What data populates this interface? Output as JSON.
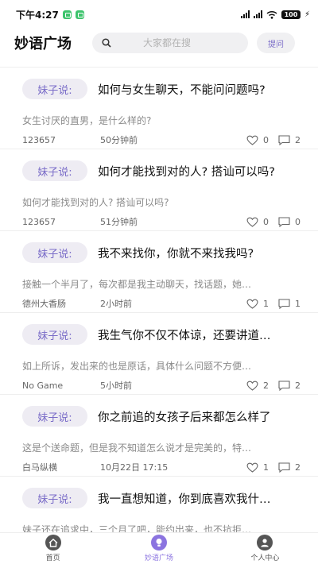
{
  "status_bar": {
    "time": "下午4:27",
    "battery": "100"
  },
  "header": {
    "title": "妙语广场",
    "search_placeholder": "大家都在搜",
    "ask_label": "提问"
  },
  "posts": [
    {
      "tag": "妹子说:",
      "title": "如何与女生聊天，不能问问题吗?",
      "desc": "女生讨厌的直男，是什么样的?",
      "author": "123657",
      "time": "50分钟前",
      "likes": "0",
      "comments": "2"
    },
    {
      "tag": "妹子说:",
      "title": "如何才能找到对的人? 搭讪可以吗?",
      "desc": "如何才能找到对的人? 搭讪可以吗?",
      "author": "123657",
      "time": "51分钟前",
      "likes": "0",
      "comments": "0"
    },
    {
      "tag": "妹子说:",
      "title": "我不来找你，你就不来找我吗?",
      "desc": "接触一个半月了，每次都是我主动聊天，找话题，她…",
      "author": "德州大香肠",
      "time": "2小时前",
      "likes": "1",
      "comments": "1"
    },
    {
      "tag": "妹子说:",
      "title": "我生气你不仅不体谅，还要讲道…",
      "desc": "如上所诉，发出来的也是原话，具体什么问题不方便…",
      "author": "No Game",
      "time": "5小时前",
      "likes": "2",
      "comments": "2"
    },
    {
      "tag": "妹子说:",
      "title": "你之前追的女孩子后来都怎么样了",
      "desc": "这是个送命题，但是我不知道怎么说才是完美的，特…",
      "author": "白马纵横",
      "time": "10月22日 17:15",
      "likes": "1",
      "comments": "2"
    },
    {
      "tag": "妹子说:",
      "title": "我一直想知道，你到底喜欢我什…",
      "desc": "妹子还在追求中，三个月了吧，能约出来，也不抗拒…",
      "author": "",
      "time": "",
      "likes": "",
      "comments": ""
    }
  ],
  "tabbar": {
    "home": "首页",
    "square": "妙语广场",
    "profile": "个人中心"
  },
  "colors": {
    "accent": "#8b74e0",
    "tag_bg": "#eeecf3"
  }
}
